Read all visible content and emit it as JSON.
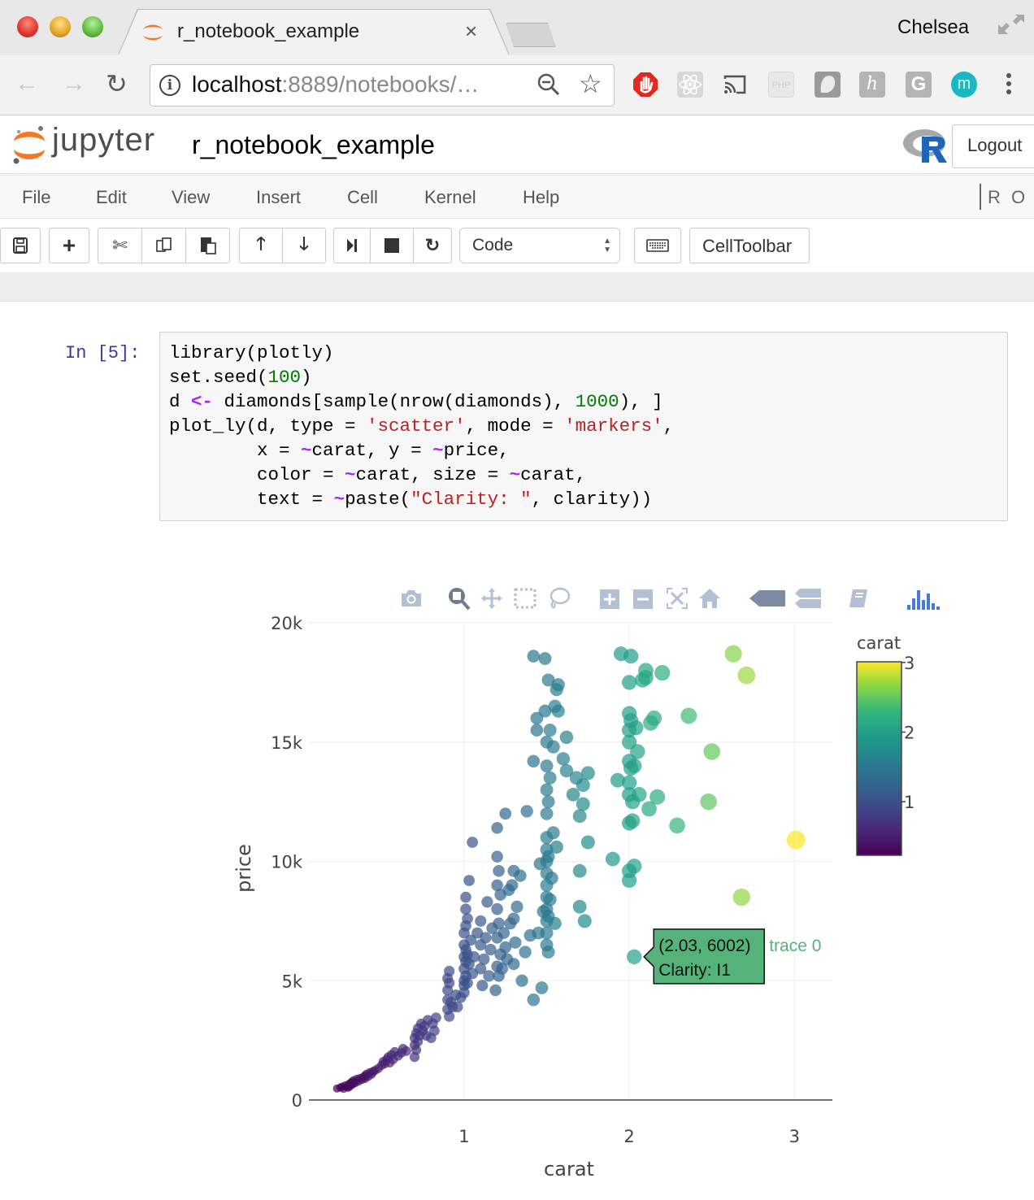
{
  "browser": {
    "tab_title": "r_notebook_example",
    "profile_name": "Chelsea",
    "url_host": "localhost",
    "url_rest": ":8889/notebooks/…",
    "extensions": [
      "adblock-icon",
      "react-devtools-icon",
      "cast-icon",
      "php-icon",
      "ghostery-icon",
      "h-extension-icon",
      "grammarly-icon",
      "m-extension-icon"
    ],
    "ext_php_label": "PHP",
    "ext_h_label": "h",
    "ext_g_label": "G",
    "ext_m_label": "m"
  },
  "jupyter": {
    "logo_text": "jupyter",
    "notebook_name": "r_notebook_example",
    "logout_label": "Logout",
    "menu": [
      "File",
      "Edit",
      "View",
      "Insert",
      "Cell",
      "Kernel",
      "Help"
    ],
    "kernel_name": "R",
    "kernel_status": "O",
    "cell_type": "Code",
    "celltoolbar_label": "CellToolbar"
  },
  "cell": {
    "prompt": "In [5]:",
    "code_lines": [
      [
        {
          "t": "library(plotly)",
          "c": ""
        }
      ],
      [
        {
          "t": "set.seed(",
          "c": ""
        },
        {
          "t": "100",
          "c": "kw-num"
        },
        {
          "t": ")",
          "c": ""
        }
      ],
      [
        {
          "t": "d ",
          "c": ""
        },
        {
          "t": "<-",
          "c": "kw-op"
        },
        {
          "t": " diamonds[sample(nrow(diamonds), ",
          "c": ""
        },
        {
          "t": "1000",
          "c": "kw-num"
        },
        {
          "t": "), ]",
          "c": ""
        }
      ],
      [
        {
          "t": "plot_ly(d, type = ",
          "c": ""
        },
        {
          "t": "'scatter'",
          "c": "kw-str"
        },
        {
          "t": ", mode = ",
          "c": ""
        },
        {
          "t": "'markers'",
          "c": "kw-str"
        },
        {
          "t": ",",
          "c": ""
        }
      ],
      [
        {
          "t": "        x = ",
          "c": ""
        },
        {
          "t": "~",
          "c": "kw-op"
        },
        {
          "t": "carat, y = ",
          "c": ""
        },
        {
          "t": "~",
          "c": "kw-op"
        },
        {
          "t": "price,",
          "c": ""
        }
      ],
      [
        {
          "t": "        color = ",
          "c": ""
        },
        {
          "t": "~",
          "c": "kw-op"
        },
        {
          "t": "carat, size = ",
          "c": ""
        },
        {
          "t": "~",
          "c": "kw-op"
        },
        {
          "t": "carat,",
          "c": ""
        }
      ],
      [
        {
          "t": "        text = ",
          "c": ""
        },
        {
          "t": "~",
          "c": "kw-op"
        },
        {
          "t": "paste(",
          "c": ""
        },
        {
          "t": "\"Clarity: \"",
          "c": "kw-str"
        },
        {
          "t": ", clarity))",
          "c": ""
        }
      ]
    ]
  },
  "modebar": [
    "camera-icon",
    "zoom-icon",
    "pan-icon",
    "box-select-icon",
    "lasso-select-icon",
    "zoom-in-icon",
    "zoom-out-icon",
    "autoscale-icon",
    "reset-axes-icon",
    "hover-closest-icon",
    "hover-compare-icon",
    "edit-in-chart-studio-icon",
    "plotly-logo-icon"
  ],
  "chart_data": {
    "type": "scatter",
    "title": "",
    "xlabel": "carat",
    "ylabel": "price",
    "xlim": [
      0.06,
      3.23
    ],
    "ylim": [
      0,
      20000
    ],
    "xticks": [
      1,
      2,
      3
    ],
    "xtick_labels": [
      "1",
      "2",
      "3"
    ],
    "yticks": [
      0,
      5000,
      10000,
      15000,
      20000
    ],
    "ytick_labels": [
      "0",
      "5k",
      "10k",
      "15k",
      "20k"
    ],
    "grid": true,
    "colorscale": "viridis",
    "colorbar": {
      "title": "carat",
      "range": [
        0.23,
        3.01
      ],
      "ticks": [
        1,
        2,
        3
      ],
      "tick_labels": [
        "1",
        "2",
        "3"
      ],
      "placement": "right"
    },
    "marker_size_by": "carat",
    "color_by": "carat",
    "series": [
      {
        "name": "trace 0",
        "points": [
          [
            0.23,
            480
          ],
          [
            0.25,
            520
          ],
          [
            0.26,
            560
          ],
          [
            0.27,
            470
          ],
          [
            0.28,
            610
          ],
          [
            0.29,
            540
          ],
          [
            0.3,
            650
          ],
          [
            0.3,
            520
          ],
          [
            0.31,
            700
          ],
          [
            0.31,
            590
          ],
          [
            0.32,
            760
          ],
          [
            0.32,
            640
          ],
          [
            0.33,
            820
          ],
          [
            0.33,
            690
          ],
          [
            0.34,
            720
          ],
          [
            0.35,
            880
          ],
          [
            0.36,
            780
          ],
          [
            0.37,
            910
          ],
          [
            0.38,
            850
          ],
          [
            0.39,
            960
          ],
          [
            0.4,
            1020
          ],
          [
            0.4,
            900
          ],
          [
            0.41,
            1090
          ],
          [
            0.42,
            990
          ],
          [
            0.43,
            1150
          ],
          [
            0.44,
            1080
          ],
          [
            0.45,
            1200
          ],
          [
            0.46,
            1240
          ],
          [
            0.48,
            1320
          ],
          [
            0.5,
            1450
          ],
          [
            0.51,
            1610
          ],
          [
            0.52,
            1520
          ],
          [
            0.53,
            1690
          ],
          [
            0.54,
            1800
          ],
          [
            0.55,
            1560
          ],
          [
            0.56,
            1900
          ],
          [
            0.57,
            1700
          ],
          [
            0.58,
            2020
          ],
          [
            0.6,
            1850
          ],
          [
            0.62,
            1980
          ],
          [
            0.63,
            2150
          ],
          [
            0.65,
            2050
          ],
          [
            0.7,
            1800
          ],
          [
            0.7,
            2300
          ],
          [
            0.7,
            2600
          ],
          [
            0.71,
            2100
          ],
          [
            0.71,
            2800
          ],
          [
            0.72,
            3000
          ],
          [
            0.72,
            2450
          ],
          [
            0.73,
            2700
          ],
          [
            0.74,
            3200
          ],
          [
            0.75,
            2900
          ],
          [
            0.76,
            3100
          ],
          [
            0.77,
            2700
          ],
          [
            0.78,
            3350
          ],
          [
            0.8,
            2600
          ],
          [
            0.81,
            3200
          ],
          [
            0.82,
            2900
          ],
          [
            0.83,
            3450
          ],
          [
            0.9,
            3800
          ],
          [
            0.9,
            4200
          ],
          [
            0.9,
            4600
          ],
          [
            0.9,
            5100
          ],
          [
            0.91,
            3500
          ],
          [
            0.91,
            4900
          ],
          [
            0.91,
            5400
          ],
          [
            0.92,
            4100
          ],
          [
            0.93,
            3900
          ],
          [
            0.95,
            4400
          ],
          [
            0.96,
            3900
          ],
          [
            0.98,
            4300
          ],
          [
            1.0,
            4500
          ],
          [
            1.0,
            5000
          ],
          [
            1.0,
            5500
          ],
          [
            1.0,
            6000
          ],
          [
            1.0,
            6500
          ],
          [
            1.0,
            7000
          ],
          [
            1.0,
            4800
          ],
          [
            1.01,
            5200
          ],
          [
            1.01,
            5800
          ],
          [
            1.01,
            6300
          ],
          [
            1.01,
            7300
          ],
          [
            1.01,
            8000
          ],
          [
            1.01,
            8500
          ],
          [
            1.02,
            4900
          ],
          [
            1.02,
            6100
          ],
          [
            1.02,
            7600
          ],
          [
            1.03,
            5700
          ],
          [
            1.03,
            9200
          ],
          [
            1.04,
            6700
          ],
          [
            1.05,
            5300
          ],
          [
            1.05,
            10800
          ],
          [
            1.06,
            6000
          ],
          [
            1.08,
            7000
          ],
          [
            1.1,
            5500
          ],
          [
            1.1,
            6500
          ],
          [
            1.1,
            7500
          ],
          [
            1.11,
            4800
          ],
          [
            1.12,
            5900
          ],
          [
            1.13,
            6800
          ],
          [
            1.14,
            8300
          ],
          [
            1.15,
            5200
          ],
          [
            1.16,
            6300
          ],
          [
            1.17,
            7200
          ],
          [
            1.19,
            4600
          ],
          [
            1.2,
            5600
          ],
          [
            1.2,
            6800
          ],
          [
            1.2,
            8000
          ],
          [
            1.2,
            9000
          ],
          [
            1.2,
            10200
          ],
          [
            1.2,
            11400
          ],
          [
            1.21,
            5200
          ],
          [
            1.21,
            7400
          ],
          [
            1.21,
            9600
          ],
          [
            1.22,
            6100
          ],
          [
            1.22,
            8600
          ],
          [
            1.23,
            5500
          ],
          [
            1.24,
            7000
          ],
          [
            1.25,
            12000
          ],
          [
            1.25,
            6400
          ],
          [
            1.26,
            5900
          ],
          [
            1.27,
            8800
          ],
          [
            1.28,
            7400
          ],
          [
            1.29,
            9000
          ],
          [
            1.3,
            5700
          ],
          [
            1.3,
            7600
          ],
          [
            1.3,
            9600
          ],
          [
            1.31,
            6600
          ],
          [
            1.32,
            8100
          ],
          [
            1.34,
            9400
          ],
          [
            1.35,
            5000
          ],
          [
            1.37,
            6200
          ],
          [
            1.38,
            12100
          ],
          [
            1.4,
            6900
          ],
          [
            1.42,
            4200
          ],
          [
            1.45,
            7000
          ],
          [
            1.5,
            6500
          ],
          [
            1.5,
            7000
          ],
          [
            1.5,
            7500
          ],
          [
            1.5,
            8000
          ],
          [
            1.5,
            8500
          ],
          [
            1.5,
            9000
          ],
          [
            1.5,
            9500
          ],
          [
            1.5,
            10000
          ],
          [
            1.5,
            10500
          ],
          [
            1.5,
            11000
          ],
          [
            1.5,
            12000
          ],
          [
            1.5,
            13000
          ],
          [
            1.5,
            14000
          ],
          [
            1.51,
            6200
          ],
          [
            1.51,
            7700
          ],
          [
            1.51,
            10200
          ],
          [
            1.51,
            12500
          ],
          [
            1.52,
            8400
          ],
          [
            1.52,
            13500
          ],
          [
            1.53,
            9300
          ],
          [
            1.54,
            11200
          ],
          [
            1.55,
            7400
          ],
          [
            1.56,
            10600
          ],
          [
            1.47,
            4700
          ],
          [
            1.48,
            7900
          ],
          [
            1.46,
            9900
          ],
          [
            1.44,
            15500
          ],
          [
            1.42,
            14200
          ],
          [
            1.49,
            16300
          ],
          [
            1.5,
            15000
          ],
          [
            1.52,
            15500
          ],
          [
            1.54,
            14800
          ],
          [
            1.55,
            16500
          ],
          [
            1.57,
            17400
          ],
          [
            1.6,
            14300
          ],
          [
            1.62,
            15200
          ],
          [
            1.62,
            13800
          ],
          [
            1.66,
            12800
          ],
          [
            1.68,
            13500
          ],
          [
            1.7,
            11900
          ],
          [
            1.7,
            9600
          ],
          [
            1.7,
            8100
          ],
          [
            1.72,
            12400
          ],
          [
            1.72,
            13200
          ],
          [
            1.73,
            7500
          ],
          [
            1.75,
            10800
          ],
          [
            1.75,
            13700
          ],
          [
            1.42,
            18600
          ],
          [
            1.49,
            18500
          ],
          [
            1.51,
            17600
          ],
          [
            1.56,
            17200
          ],
          [
            1.57,
            16300
          ],
          [
            1.44,
            16000
          ],
          [
            1.9,
            10100
          ],
          [
            1.93,
            13400
          ],
          [
            1.95,
            18700
          ],
          [
            2.0,
            17500
          ],
          [
            2.0,
            16200
          ],
          [
            2.0,
            15500
          ],
          [
            2.0,
            15000
          ],
          [
            2.0,
            14200
          ],
          [
            2.0,
            13300
          ],
          [
            2.0,
            12800
          ],
          [
            2.0,
            11600
          ],
          [
            2.0,
            9600
          ],
          [
            2.0,
            9200
          ],
          [
            2.01,
            18600
          ],
          [
            2.01,
            15900
          ],
          [
            2.01,
            13900
          ],
          [
            2.02,
            12500
          ],
          [
            2.02,
            11700
          ],
          [
            2.03,
            14000
          ],
          [
            2.03,
            9800
          ],
          [
            2.03,
            6002
          ],
          [
            2.04,
            15600
          ],
          [
            2.05,
            14600
          ],
          [
            2.06,
            12800
          ],
          [
            2.08,
            17600
          ],
          [
            2.1,
            18000
          ],
          [
            2.1,
            17700
          ],
          [
            2.12,
            12200
          ],
          [
            2.13,
            15800
          ],
          [
            2.15,
            16000
          ],
          [
            2.17,
            12700
          ],
          [
            2.2,
            17900
          ],
          [
            2.29,
            11500
          ],
          [
            2.36,
            16100
          ],
          [
            2.48,
            12500
          ],
          [
            2.5,
            14600
          ],
          [
            2.63,
            18700
          ],
          [
            2.68,
            8500
          ],
          [
            2.71,
            17800
          ],
          [
            3.01,
            10900
          ]
        ]
      }
    ],
    "hover": {
      "x": 2.03,
      "y": 6002,
      "label_line1": "(2.03, 6002)",
      "label_line2": "Clarity:  I1",
      "trace_name": "trace 0",
      "bgcolor": "#55b27a"
    }
  }
}
